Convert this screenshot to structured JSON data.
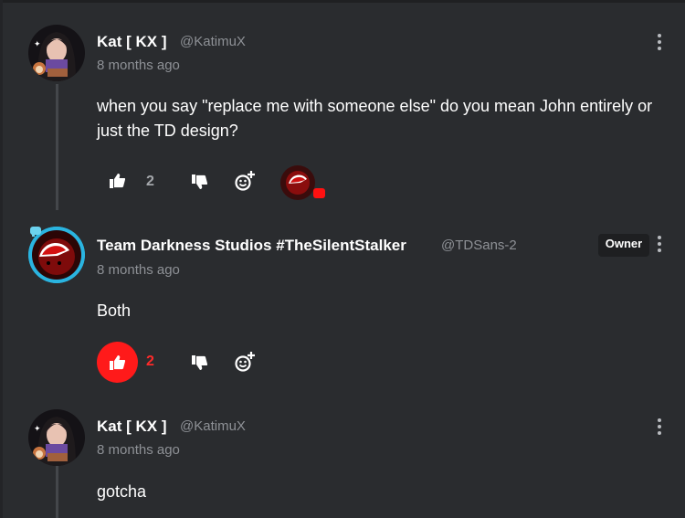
{
  "comments": [
    {
      "author": "Kat [ KX ]",
      "handle": "@KatimuX",
      "time": "8 months ago",
      "text": "when you say \"replace me with someone else\" do you mean John entirely or just the TD design?",
      "likes": "2"
    },
    {
      "author": "Team Darkness Studios #TheSilentStalker",
      "handle": "@TDSans-2",
      "time": "8 months ago",
      "badge": "Owner",
      "text": "Both",
      "likes": "2"
    },
    {
      "author": "Kat [ KX ]",
      "handle": "@KatimuX",
      "time": "8 months ago",
      "text": "gotcha"
    }
  ],
  "icons": {
    "like": "thumbs-up-icon",
    "dislike": "thumbs-down-icon",
    "react": "add-reaction-icon",
    "more": "more-options-icon"
  },
  "colors": {
    "background": "#2a2c2f",
    "liked": "#ff1a1a",
    "muted_text": "#8e9196"
  }
}
